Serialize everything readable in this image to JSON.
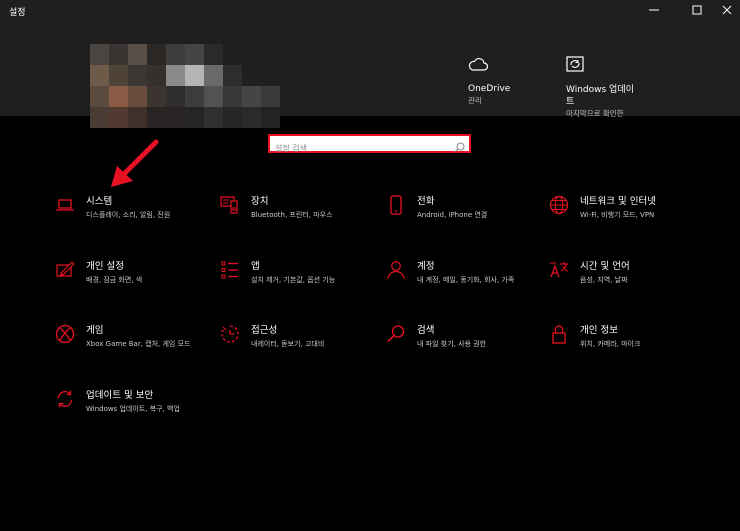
{
  "window": {
    "title": "설정",
    "minimize": "—",
    "maximize": "☐",
    "close": "✕"
  },
  "colors": {
    "accent": "#e81123",
    "background": "#000000",
    "header_bg": "#1f1f1f"
  },
  "header": {
    "onedrive": {
      "label": "OneDrive",
      "sub": "관리",
      "icon": "cloud-icon"
    },
    "windows_update": {
      "label_line1": "Windows 업데이",
      "label_line2": "트",
      "sub": "마지막으로 확인한",
      "icon": "update-icon"
    }
  },
  "search": {
    "placeholder": "설정 검색",
    "value": ""
  },
  "categories": [
    {
      "name": "시스템",
      "desc": "디스플레이, 소리, 알림, 전원",
      "icon": "laptop-icon"
    },
    {
      "name": "장치",
      "desc": "Bluetooth, 프린터, 마우스",
      "icon": "devices-icon"
    },
    {
      "name": "전화",
      "desc": "Android, iPhone 연결",
      "icon": "phone-icon"
    },
    {
      "name": "네트워크 및 인터넷",
      "desc": "Wi-Fi, 비행기 모드, VPN",
      "icon": "globe-icon"
    },
    {
      "name": "개인 설정",
      "desc": "배경, 잠금 화면, 색",
      "icon": "personalization-icon"
    },
    {
      "name": "앱",
      "desc": "설치 제거, 기본값, 옵션 기능",
      "icon": "apps-icon"
    },
    {
      "name": "계정",
      "desc": "내 계정, 메일, 동기화, 회사, 가족",
      "icon": "person-icon"
    },
    {
      "name": "시간 및 언어",
      "desc": "음성, 지역, 날짜",
      "icon": "language-icon"
    },
    {
      "name": "게임",
      "desc": "Xbox Game Bar, 캡처, 게임 모드",
      "icon": "xbox-icon"
    },
    {
      "name": "접근성",
      "desc": "내레이터, 돋보기, 고대비",
      "icon": "accessibility-icon"
    },
    {
      "name": "검색",
      "desc": "내 파일 찾기, 사용 권한",
      "icon": "search-icon"
    },
    {
      "name": "개인 정보",
      "desc": "위치, 카메라, 마이크",
      "icon": "lock-icon"
    },
    {
      "name": "업데이트 및 보안",
      "desc": "Windows 업데이트, 복구, 백업",
      "icon": "sync-icon"
    }
  ]
}
